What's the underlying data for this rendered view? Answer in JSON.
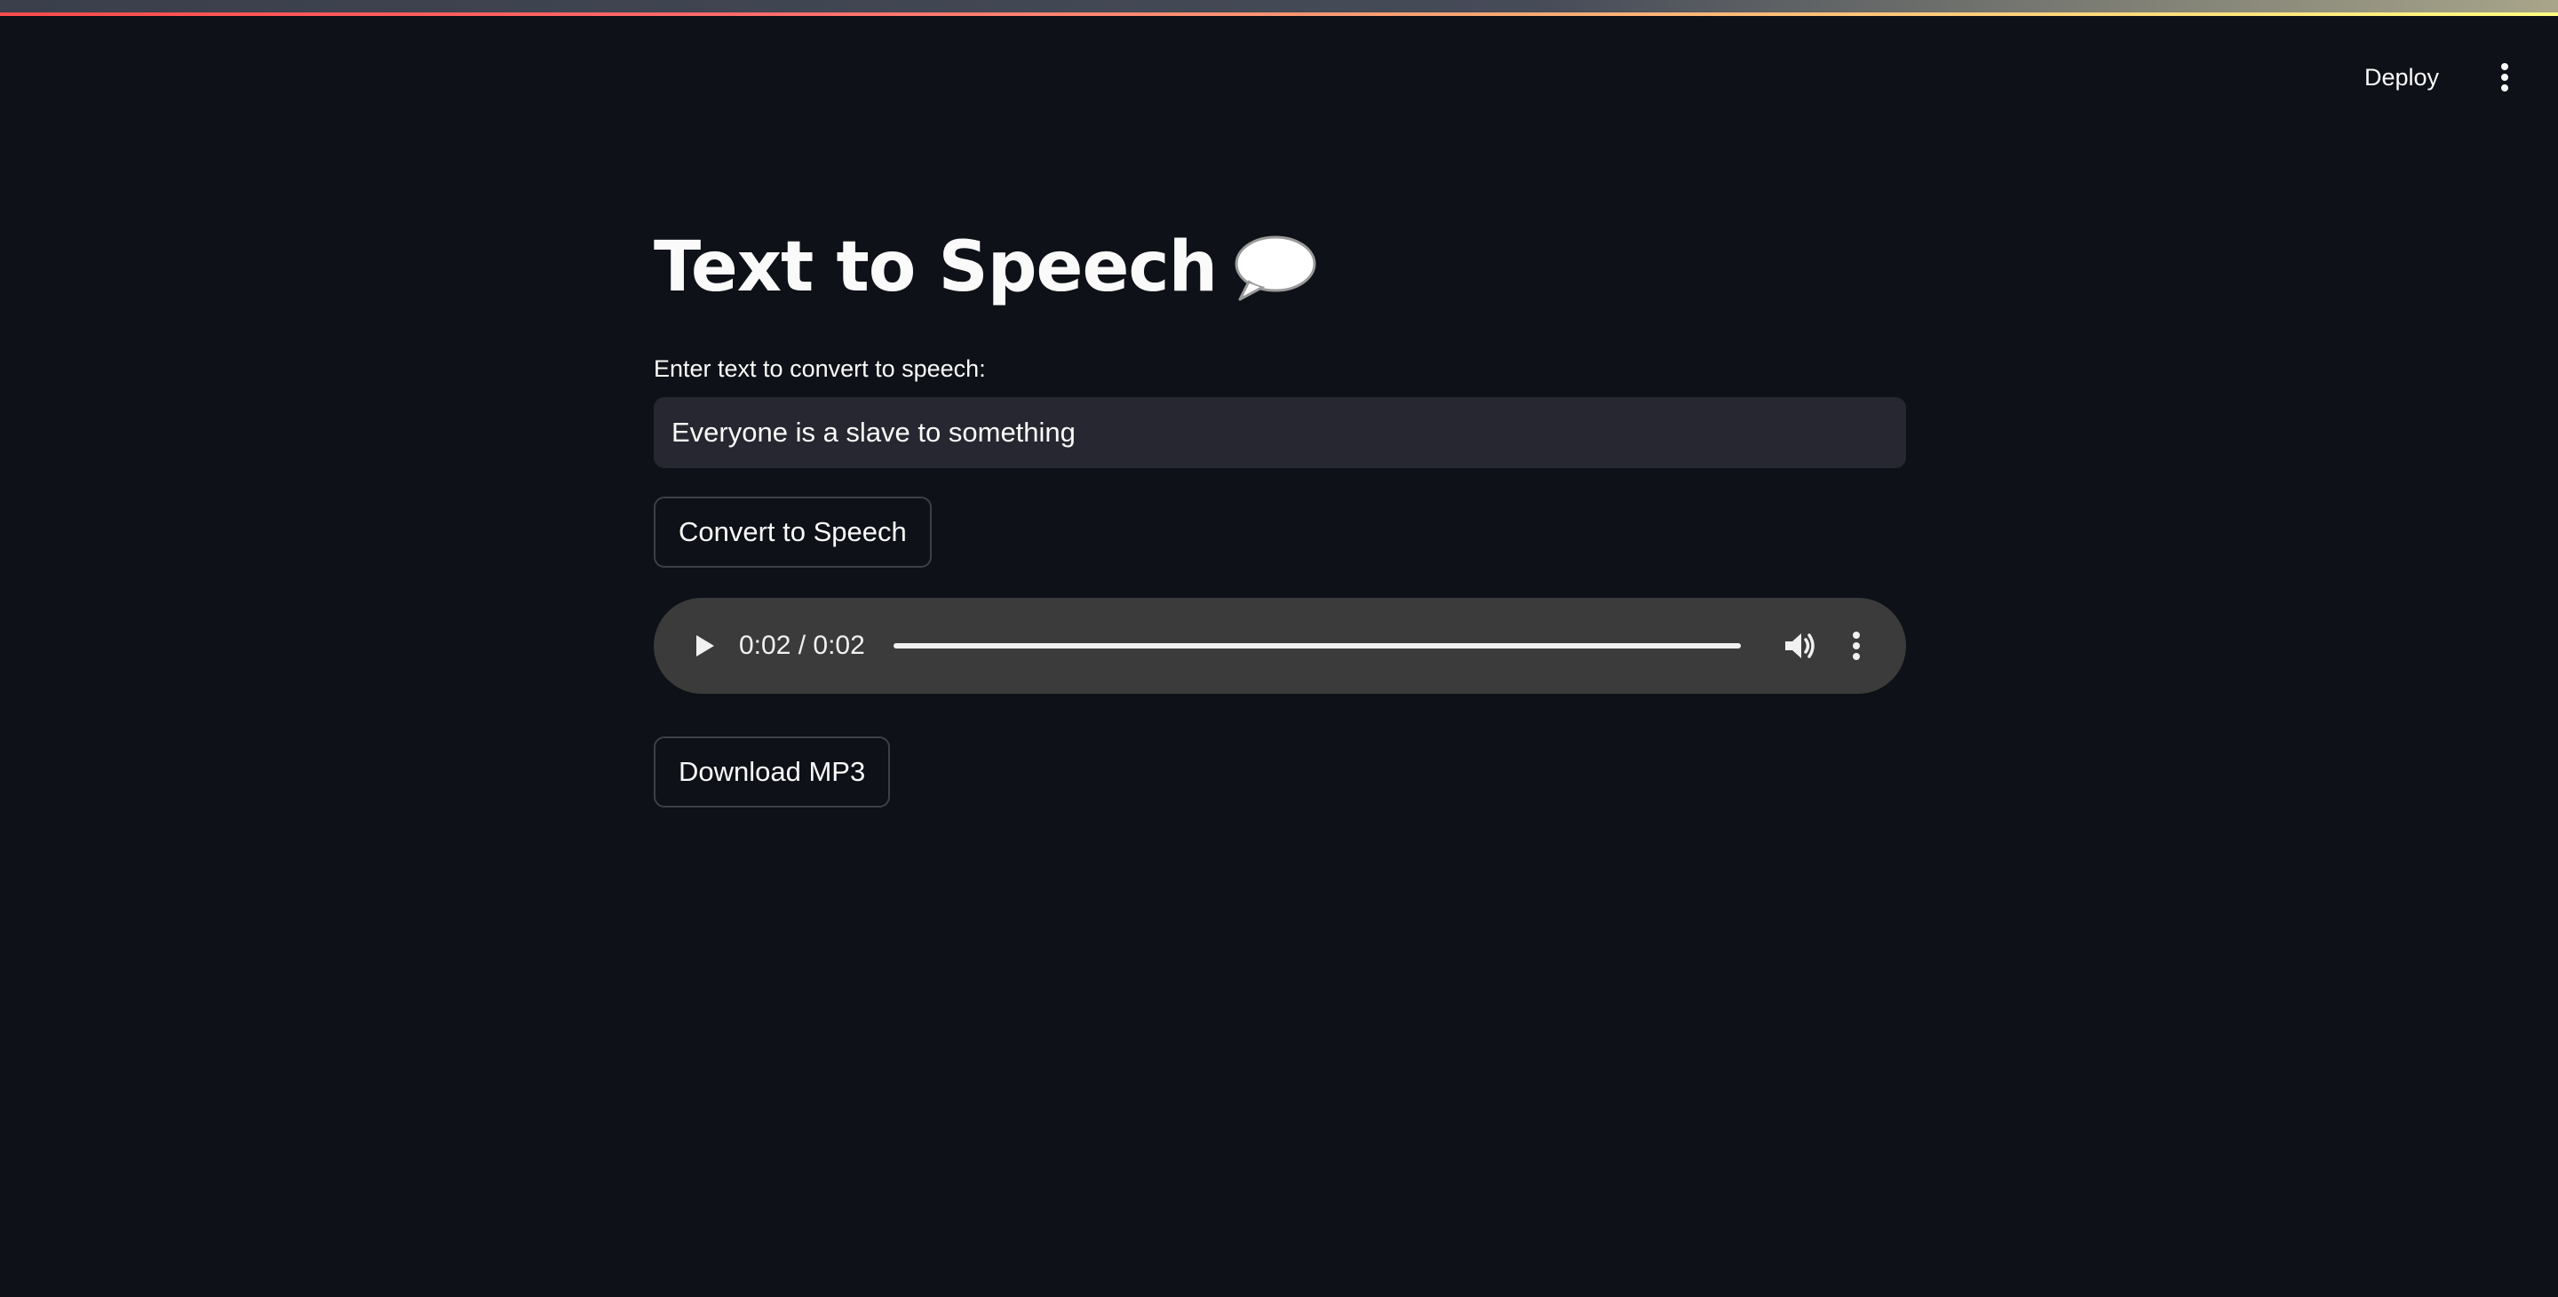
{
  "header": {
    "deploy_label": "Deploy",
    "menu_icon": "vertical-dots-icon"
  },
  "main": {
    "title": "Text to Speech",
    "title_icon": "speech-bubble-icon",
    "input_label": "Enter text to convert to speech:",
    "input_value": "Everyone is a slave to something",
    "convert_label": "Convert to Speech",
    "download_label": "Download MP3"
  },
  "audio": {
    "time": "0:02 / 0:02",
    "progress": 1.0,
    "play_icon": "play-icon",
    "volume_icon": "volume-icon",
    "options_icon": "vertical-dots-icon"
  },
  "colors": {
    "background": "#0e1117",
    "input_background": "#262730",
    "player_background": "#3b3b3b",
    "text": "#fafafa"
  }
}
